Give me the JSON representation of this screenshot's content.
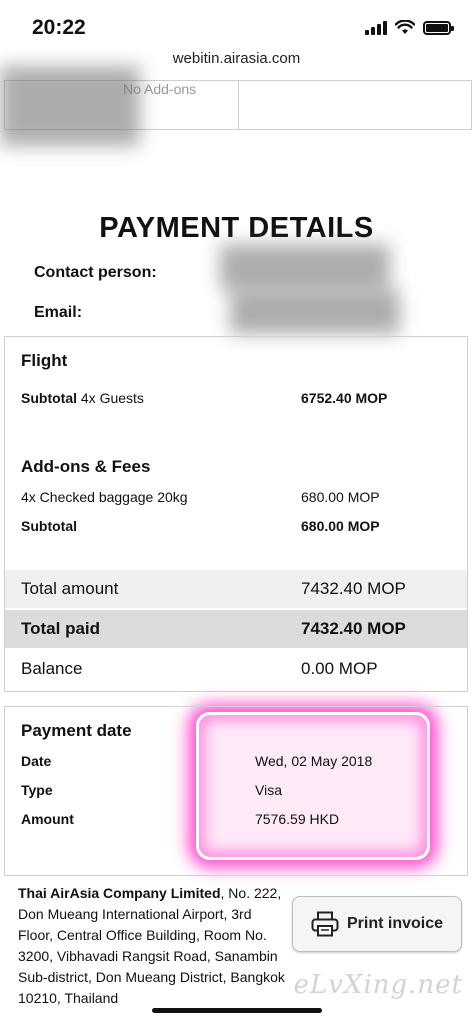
{
  "status_bar": {
    "time": "20:22"
  },
  "browser": {
    "url": "webitin.airasia.com"
  },
  "top_section": {
    "faded_text": "No Add-ons"
  },
  "page": {
    "title": "PAYMENT DETAILS",
    "contact_label": "Contact person:",
    "email_label": "Email:"
  },
  "flight": {
    "heading": "Flight",
    "subtotal_label": "Subtotal",
    "guests": "4x Guests",
    "subtotal_value": "6752.40 MOP"
  },
  "addons": {
    "heading": "Add-ons & Fees",
    "item_label": "4x Checked baggage 20kg",
    "item_value": "680.00 MOP",
    "subtotal_label": "Subtotal",
    "subtotal_value": "680.00 MOP"
  },
  "totals": {
    "total_amount_label": "Total amount",
    "total_amount_value": "7432.40 MOP",
    "total_paid_label": "Total paid",
    "total_paid_value": "7432.40 MOP",
    "balance_label": "Balance",
    "balance_value": "0.00 MOP"
  },
  "payment": {
    "heading": "Payment date",
    "date_label": "Date",
    "date_value": "Wed, 02 May 2018",
    "type_label": "Type",
    "type_value": "Visa",
    "amount_label": "Amount",
    "amount_value": "7576.59 HKD"
  },
  "footer": {
    "company_name": "Thai AirAsia Company Limited",
    "address": ", No. 222, Don Mueang International Airport, 3rd Floor, Central Office Building, Room No. 3200, Vibhavadi Rangsit Road, Sanambin Sub-district, Don Mueang District, Bangkok 10210, Thailand",
    "print_button": "Print invoice",
    "watermark": "eLvXing.net"
  },
  "colors": {
    "highlight": "#ff4fcf",
    "band_light": "#f0f0f0",
    "band_dark": "#dcdcdc"
  }
}
